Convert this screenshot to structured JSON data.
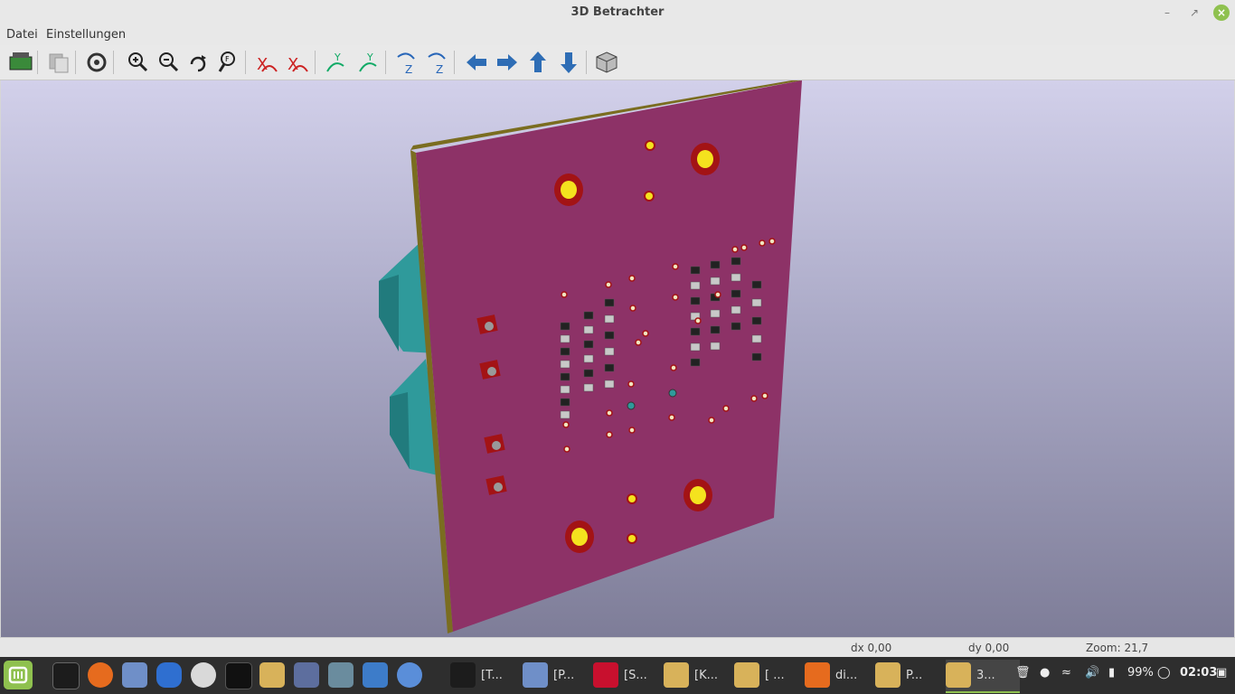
{
  "window": {
    "title": "3D Betrachter"
  },
  "menu": [
    "Datei",
    "Einstellungen"
  ],
  "toolbar": [
    {
      "name": "reload-board-icon"
    },
    {
      "name": "copy-image-icon"
    },
    {
      "name": "settings-icon"
    },
    {
      "name": "zoom-in-icon"
    },
    {
      "name": "zoom-out-icon"
    },
    {
      "name": "redraw-icon"
    },
    {
      "name": "zoom-fit-icon"
    },
    {
      "name": "rotate-x-cw-icon"
    },
    {
      "name": "rotate-x-ccw-icon"
    },
    {
      "name": "rotate-y-cw-icon"
    },
    {
      "name": "rotate-y-ccw-icon"
    },
    {
      "name": "rotate-z-cw-icon"
    },
    {
      "name": "rotate-z-ccw-icon"
    },
    {
      "name": "move-left-icon"
    },
    {
      "name": "move-right-icon"
    },
    {
      "name": "move-up-icon"
    },
    {
      "name": "move-down-icon"
    },
    {
      "name": "ortho-view-icon"
    }
  ],
  "status": {
    "dx": "dx 0,00",
    "dy": "dy 0,00",
    "zoom": "Zoom: 21,7"
  },
  "taskbar": {
    "windows": [
      {
        "label": "[T...",
        "icon": "terminal-icon"
      },
      {
        "label": "[P...",
        "icon": "mail-icon"
      },
      {
        "label": "[S...",
        "icon": "opera-icon"
      },
      {
        "label": "[K...",
        "icon": "kicad-icon"
      },
      {
        "label": "[ ...",
        "icon": "kicad-icon"
      },
      {
        "label": "di...",
        "icon": "firefox-icon"
      },
      {
        "label": "P...",
        "icon": "kicad-icon"
      },
      {
        "label": "3...",
        "icon": "kicad-icon"
      }
    ],
    "battery": "99%",
    "clock": "02:03"
  },
  "colors": {
    "board": "#8d3267",
    "board_edge": "#7a6d20",
    "pad": "#f4e21e",
    "ring": "#a31315",
    "accent": "#8fc14f"
  }
}
